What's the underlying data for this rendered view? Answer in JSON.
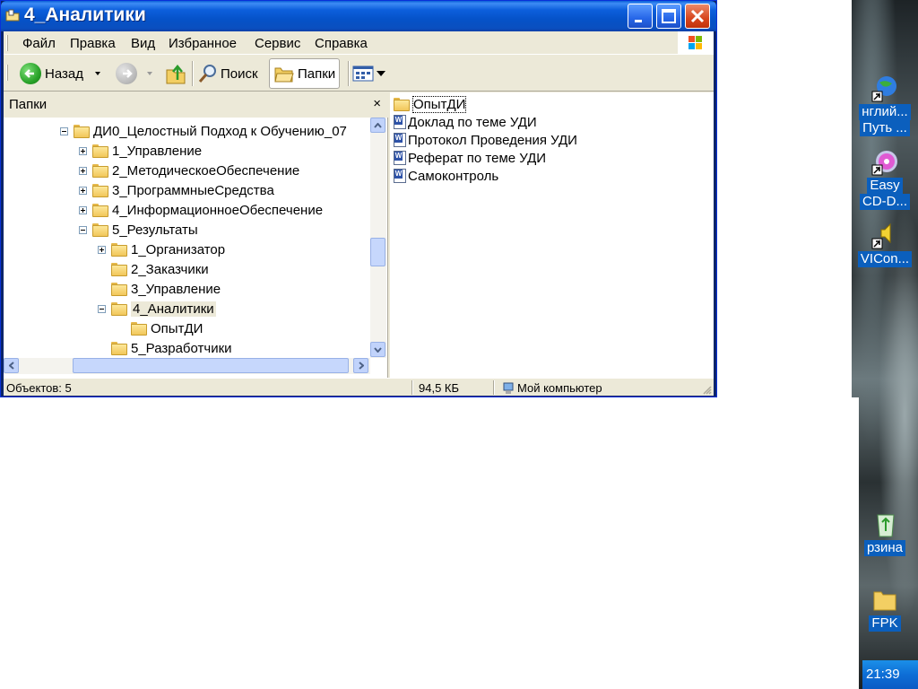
{
  "window": {
    "title": "4_Аналитики"
  },
  "menu": [
    "Файл",
    "Правка",
    "Вид",
    "Избранное",
    "Сервис",
    "Справка"
  ],
  "toolbar": {
    "back": "Назад",
    "search": "Поиск",
    "folders": "Папки"
  },
  "folders_pane": {
    "header": "Папки",
    "close": "×",
    "tree": [
      {
        "label": "ДИ0_Целостный Подход к Обучению_07",
        "expander": "minus",
        "level": 0
      },
      {
        "label": "1_Управление",
        "expander": "plus",
        "level": 1
      },
      {
        "label": "2_МетодическоеОбеспечение",
        "expander": "plus",
        "level": 1
      },
      {
        "label": "3_ПрограммныеСредства",
        "expander": "plus",
        "level": 1
      },
      {
        "label": "4_ИнформационноеОбеспечение",
        "expander": "plus",
        "level": 1
      },
      {
        "label": "5_Результаты",
        "expander": "minus",
        "level": 1
      },
      {
        "label": "1_Организатор",
        "expander": "plus",
        "level": 2
      },
      {
        "label": "2_Заказчики",
        "expander": "none",
        "level": 2
      },
      {
        "label": "3_Управление",
        "expander": "none",
        "level": 2
      },
      {
        "label": "4_Аналитики",
        "expander": "minus",
        "level": 2,
        "selected": true
      },
      {
        "label": "ОпытДИ",
        "expander": "none",
        "level": 3
      },
      {
        "label": "5_Разработчики",
        "expander": "none",
        "level": 2
      }
    ]
  },
  "files": [
    {
      "name": "ОпытДИ",
      "type": "folder"
    },
    {
      "name": "Доклад по теме УДИ",
      "type": "doc"
    },
    {
      "name": "Протокол Проведения УДИ",
      "type": "doc"
    },
    {
      "name": "Реферат по теме УДИ",
      "type": "doc"
    },
    {
      "name": "Самоконтроль",
      "type": "doc"
    }
  ],
  "status": {
    "objects": "Объектов: 5",
    "size": "94,5 КБ",
    "location": "Мой компьютер"
  },
  "desktop": {
    "icons": [
      {
        "label_line1": "нглий...",
        "label_line2": "Путь ..."
      },
      {
        "label_line1": "Easy",
        "label_line2": "CD-D..."
      },
      {
        "label_line1": "VICon..."
      },
      {
        "label_line1": "рзина"
      },
      {
        "label_line1": "FPK"
      }
    ],
    "clock": "21:39"
  }
}
